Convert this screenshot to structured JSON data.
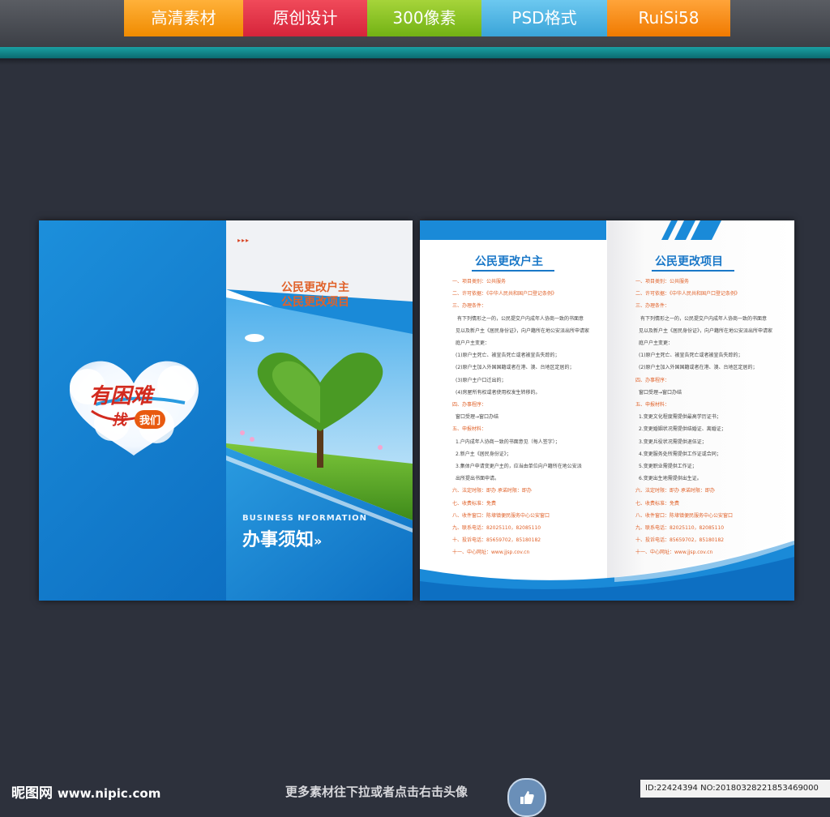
{
  "header": {
    "tabs": [
      "高清素材",
      "原创设计",
      "300像素",
      "PSD格式",
      "RuiSi58"
    ]
  },
  "left_sheet": {
    "slogan_top": "有困难",
    "slogan_find": "找",
    "slogan_us": "我们",
    "subtitle_1": "公民更改户主",
    "subtitle_2": "公民更改项目",
    "business_en": "BUSINESS NFORMATION",
    "business_cn": "办事须知",
    "arrow": "»"
  },
  "right_sheet": {
    "col1_title": "公民更改户主",
    "col2_title": "公民更改项目",
    "col1_lines": [
      {
        "t": "一、项目类别：公共服务",
        "o": true
      },
      {
        "t": "二、许可依据：《中华人民共和国户口登记条例》",
        "o": true
      },
      {
        "t": "三、办理条件：",
        "o": true
      },
      {
        "t": "有下列情形之一的，公民提交户内成年人协商一致的书面意",
        "o": false
      },
      {
        "t": "见以及新户主《居民身份证》，向户籍所在地公安派出所申请家",
        "o": false
      },
      {
        "t": "庭户户主变更：",
        "o": false
      },
      {
        "t": "(1)原户主死亡、被宣告死亡或者被宣告失踪的；",
        "o": false
      },
      {
        "t": "(2)原户主加入外国国籍或者在港、澳、台地区定居的；",
        "o": false
      },
      {
        "t": "(3)原户主户口迁出的；",
        "o": false
      },
      {
        "t": "(4)房屋所有权或者使用权发生转移的。",
        "o": false
      },
      {
        "t": "四、办事程序：",
        "o": true
      },
      {
        "t": "窗口受理→窗口办结",
        "o": false
      },
      {
        "t": "五、申报材料：",
        "o": true
      },
      {
        "t": "1.户内成年人协商一致的书面意见（每人签字）；",
        "o": false
      },
      {
        "t": "2.新户主《居民身份证》；",
        "o": false
      },
      {
        "t": "3.集体户申请变更户主的，应当由单位向户籍所在地公安派",
        "o": false
      },
      {
        "t": "出所提出书面申请。",
        "o": false
      },
      {
        "t": "六、法定时限：即办    承诺时限：即办",
        "o": true
      },
      {
        "t": "七、收费标准：免费",
        "o": true
      },
      {
        "t": "八、收件窗口：陈埭镇便民服务中心公安窗口",
        "o": true
      },
      {
        "t": "九、联系电话：82025110，82085110",
        "o": true
      },
      {
        "t": "十、投诉电话：85659702，85180182",
        "o": true
      },
      {
        "t": "十一、中心网址：www.jjsp.cov.cn",
        "o": true
      }
    ],
    "col2_lines": [
      {
        "t": "一、项目类别：公共服务",
        "o": true
      },
      {
        "t": "二、许可依据：《中华人民共和国户口登记条例》",
        "o": true
      },
      {
        "t": "三、办理条件：",
        "o": true
      },
      {
        "t": "有下列情形之一的，公民提交户内成年人协商一致的书面意",
        "o": false
      },
      {
        "t": "见以及新户主《居民身份证》，向户籍所在地公安派出所申请家",
        "o": false
      },
      {
        "t": "庭户户主变更：",
        "o": false
      },
      {
        "t": "(1)原户主死亡、被宣告死亡或者被宣告失踪的；",
        "o": false
      },
      {
        "t": "(2)原户主加入外国国籍或者在港、澳、台地区定居的；",
        "o": false
      },
      {
        "t": "四、办事程序：",
        "o": true
      },
      {
        "t": "窗口受理→窗口办结",
        "o": false
      },
      {
        "t": "五、申报材料：",
        "o": true
      },
      {
        "t": "1.变更文化程度需提供最高学历证书；",
        "o": false
      },
      {
        "t": "2.变更婚姻状况需提供结婚证、离婚证；",
        "o": false
      },
      {
        "t": "3.变更兵役状况需提供退伍证；",
        "o": false
      },
      {
        "t": "4.变更服务处所需提供工作证或合同；",
        "o": false
      },
      {
        "t": "5.变更职业需提供工作证；",
        "o": false
      },
      {
        "t": "6.变更出生地需提供出生证。",
        "o": false
      },
      {
        "t": "六、法定时限：即办    承诺时限：即办",
        "o": true
      },
      {
        "t": "七、收费标准：免费",
        "o": true
      },
      {
        "t": "八、收件窗口：陈埭镇便民服务中心公安窗口",
        "o": true
      },
      {
        "t": "九、联系电话：82025110，82085110",
        "o": true
      },
      {
        "t": "十、投诉电话：85659702，85180182",
        "o": true
      },
      {
        "t": "十一、中心网址：www.jjsp.cov.cn",
        "o": true
      }
    ]
  },
  "footer": {
    "logo_cn": "昵图网",
    "logo_url": "www.nipic.com",
    "center_text": "更多素材往下拉或者点击右击头像",
    "id_text": "ID:22424394 NO:20180328221853469000"
  },
  "colors": {
    "brand_blue": "#1a78c8",
    "accent_orange": "#e0622a",
    "teal": "#1aa0a2"
  }
}
